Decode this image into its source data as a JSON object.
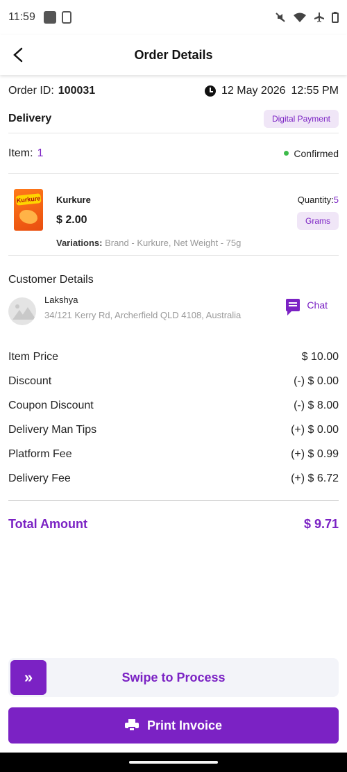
{
  "status_bar": {
    "time": "11:59"
  },
  "app_bar": {
    "title": "Order Details"
  },
  "order": {
    "id_label": "Order ID:",
    "id": "100031",
    "date": "12 May 2026",
    "time": "12:55 PM",
    "type": "Delivery",
    "payment_badge": "Digital Payment",
    "item_label": "Item:",
    "item_count": "1",
    "status": "Confirmed",
    "status_color": "#3dbb4a"
  },
  "product": {
    "name": "Kurkure",
    "price": "$ 2.00",
    "quantity_label": "Quantity:",
    "quantity": "5",
    "unit": "Grams",
    "variations_label": "Variations:",
    "variations": " Brand - Kurkure,  Net Weight - 75g",
    "image_text": "Kurkure"
  },
  "customer": {
    "section_title": "Customer Details",
    "name": "Lakshya",
    "address": "34/121 Kerry Rd, Archerfield QLD 4108, Australia",
    "chat_label": "Chat"
  },
  "pricing": {
    "rows": [
      {
        "label": "Item Price",
        "value": "$ 10.00"
      },
      {
        "label": "Discount",
        "value": "(-) $ 0.00"
      },
      {
        "label": "Coupon Discount",
        "value": "(-) $ 8.00"
      },
      {
        "label": "Delivery Man Tips",
        "value": "(+) $ 0.00"
      },
      {
        "label": "Platform Fee",
        "value": "(+) $ 0.99"
      },
      {
        "label": "Delivery Fee",
        "value": "(+) $ 6.72"
      }
    ],
    "total_label": "Total Amount",
    "total_value": "$ 9.71"
  },
  "actions": {
    "swipe_label": "Swipe to Process",
    "swipe_handle_glyph": "»",
    "print_label": "Print Invoice"
  },
  "theme": {
    "accent": "#7b22c4",
    "badge_bg": "#f0e6f7"
  }
}
